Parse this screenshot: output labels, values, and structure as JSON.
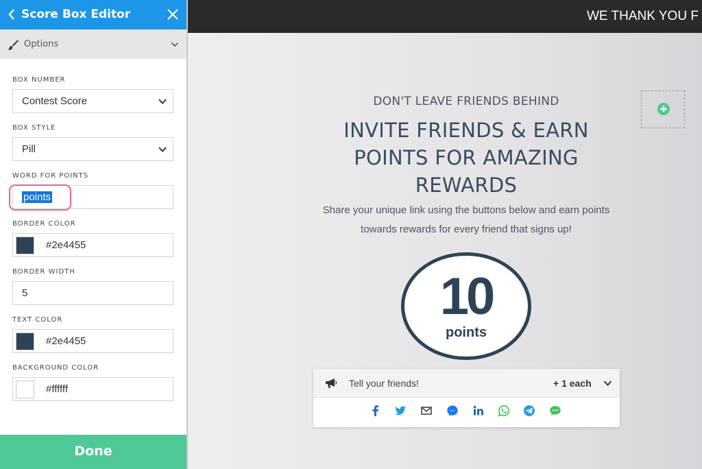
{
  "editor": {
    "title": "Score Box Editor",
    "options_label": "Options",
    "fields": {
      "box_number": {
        "label": "BOX NUMBER",
        "value": "Contest Score"
      },
      "box_style": {
        "label": "BOX STYLE",
        "value": "Pill"
      },
      "word_for_points": {
        "label": "WORD FOR POINTS",
        "value": "points"
      },
      "border_color": {
        "label": "BORDER COLOR",
        "value": "#2e4455"
      },
      "border_width": {
        "label": "BORDER WIDTH",
        "value": "5"
      },
      "text_color": {
        "label": "TEXT COLOR",
        "value": "#2e4455"
      },
      "background_color": {
        "label": "BACKGROUND COLOR",
        "value": "#ffffff"
      }
    },
    "done_label": "Done",
    "colors": {
      "header": "#1e96e8",
      "done": "#4fc997",
      "highlight": "#e4678a"
    }
  },
  "preview": {
    "banner_text": "WE THANK YOU F",
    "subheading": "DON'T LEAVE FRIENDS BEHIND",
    "heading": "INVITE FRIENDS & EARN POINTS FOR AMAZING REWARDS",
    "description": "Share your unique link using the buttons below and earn points towards rewards for every friend that signs up!",
    "score": {
      "value": "10",
      "word": "points"
    },
    "share": {
      "label": "Tell your friends!",
      "bonus": "+ 1 each",
      "icons": [
        "facebook-icon",
        "twitter-icon",
        "email-icon",
        "messenger-icon",
        "linkedin-icon",
        "whatsapp-icon",
        "telegram-icon",
        "sms-icon"
      ]
    }
  }
}
